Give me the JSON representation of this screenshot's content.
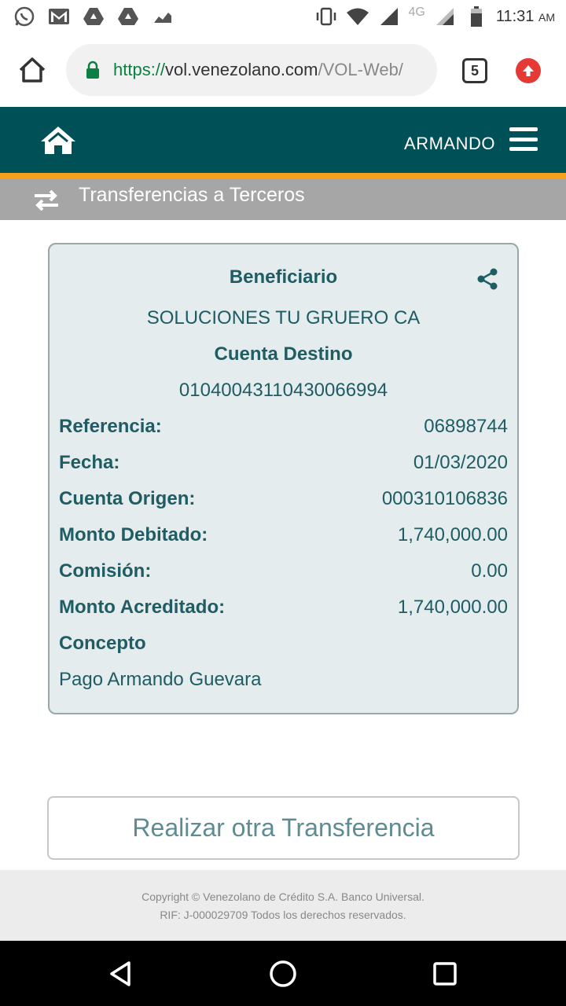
{
  "status_bar": {
    "time": "11:31",
    "ampm": "AM",
    "network": "4G",
    "icons": [
      "whatsapp-icon",
      "gmail-icon",
      "drive-icon",
      "drive-icon",
      "chart-icon",
      "vibrate-icon",
      "wifi-icon",
      "signal-icon",
      "battery-icon"
    ]
  },
  "browser": {
    "url_scheme": "https://",
    "url_host": "vol.venezolano.com",
    "url_path": "/VOL-Web/",
    "tab_count": "5"
  },
  "header": {
    "user_name": "ARMANDO",
    "bg_color": "#005058",
    "accent_color": "#f4a11b"
  },
  "subheader": {
    "title": "Transferencias a Terceros"
  },
  "receipt": {
    "beneficiary_label": "Beneficiario",
    "beneficiary_name": "SOLUCIONES TU GRUERO CA",
    "destination_label": "Cuenta Destino",
    "destination_account": "01040043110430066994",
    "rows": [
      {
        "label": "Referencia:",
        "value": "06898744"
      },
      {
        "label": "Fecha:",
        "value": "01/03/2020"
      },
      {
        "label": "Cuenta Origen:",
        "value": "000310106836"
      },
      {
        "label": "Monto Debitado:",
        "value": "1,740,000.00"
      },
      {
        "label": "Comisión:",
        "value": "0.00"
      },
      {
        "label": "Monto Acreditado:",
        "value": "1,740,000.00"
      }
    ],
    "concept_label": "Concepto",
    "concept_value": "Pago Armando Guevara"
  },
  "actions": {
    "another_transfer": "Realizar otra Transferencia"
  },
  "footer": {
    "line1": "Copyright © Venezolano de Crédito S.A. Banco Universal.",
    "line2": "RIF: J-000029709 Todos los derechos reservados."
  }
}
